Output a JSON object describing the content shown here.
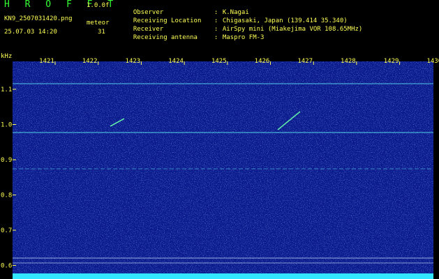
{
  "header": {
    "brand": "H R O F F T",
    "version": "1.0.0f",
    "filename": "KN9_2507031420.png",
    "meteor_label": "meteor",
    "datetime": "25.07.03 14:20",
    "meteor_count": "31"
  },
  "info": [
    {
      "label": "Observer",
      "value": "K.Nagai"
    },
    {
      "label": "Receiving Location",
      "value": "Chigasaki, Japan (139.414 35.340)"
    },
    {
      "label": "Receiver",
      "value": "AirSpy mini (Miakejima VOR 108.65MHz)"
    },
    {
      "label": "Receiving antenna",
      "value": "Maspro FM-3"
    }
  ],
  "axes": {
    "y_unit": "kHz",
    "x_ticks": [
      "1421",
      "1422",
      "1423",
      "1424",
      "1425",
      "1426",
      "1427",
      "1428",
      "1429",
      "1430"
    ],
    "y_ticks": [
      "1.1",
      "1.0",
      "0.9",
      "0.8",
      "0.7",
      "0.6"
    ]
  },
  "colors": {
    "background": "#0a1a8c",
    "text": "#ffff55",
    "brand": "#33ff33",
    "signal": "#66ffff"
  },
  "sep": ":"
}
